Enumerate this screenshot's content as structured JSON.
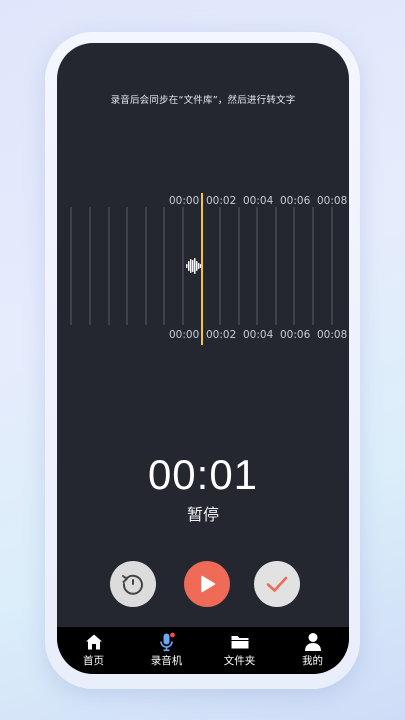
{
  "hint_text": "录音后会同步在“文件库”，然后进行转文字",
  "timeline": {
    "top_labels": [
      "00:00",
      "00:02",
      "00:04",
      "00:06",
      "00:08"
    ],
    "bottom_labels": [
      "00:00",
      "00:02",
      "00:04",
      "00:06",
      "00:08"
    ],
    "playhead_color": "#f3c53b"
  },
  "timer": "00:01",
  "state_label": "暂停",
  "controls": {
    "reset_icon": "reset-icon",
    "play_icon": "play-icon",
    "confirm_icon": "check-icon",
    "play_color": "#ef6a57",
    "check_color": "#ef6a57"
  },
  "tabs": [
    {
      "label": "首页",
      "icon": "home-icon"
    },
    {
      "label": "录音机",
      "icon": "microphone-icon",
      "active": true
    },
    {
      "label": "文件夹",
      "icon": "folder-icon"
    },
    {
      "label": "我的",
      "icon": "user-icon"
    }
  ]
}
